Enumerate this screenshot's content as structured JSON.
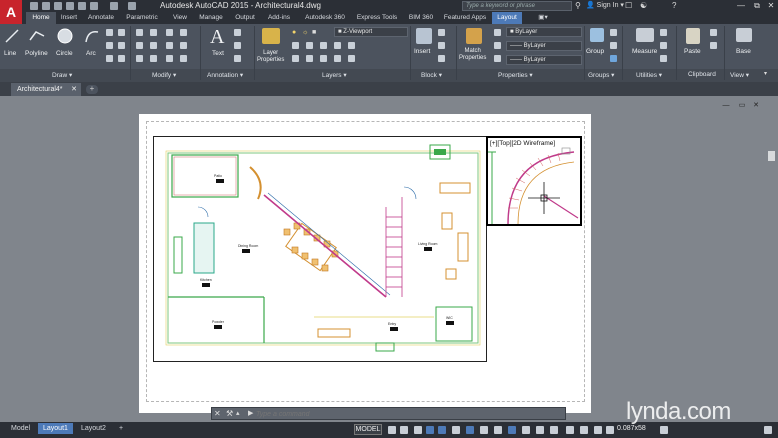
{
  "titlebar": {
    "title": "Autodesk AutoCAD 2015 - Architectural4.dwg",
    "search_placeholder": "Type a keyword or phrase",
    "signin": "Sign In",
    "app_letter": "A"
  },
  "ribbon_tabs": [
    "Home",
    "Insert",
    "Annotate",
    "Parametric",
    "View",
    "Manage",
    "Output",
    "Add-ins",
    "Autodesk 360",
    "Express Tools",
    "BIM 360",
    "Featured Apps",
    "Layout"
  ],
  "ribbon": {
    "draw_tools": [
      "Line",
      "Polyline",
      "Circle",
      "Arc"
    ],
    "panels": [
      "Draw",
      "Modify",
      "Annotation",
      "Layers",
      "Block",
      "Properties",
      "Groups",
      "Utilities",
      "Clipboard",
      "View"
    ],
    "text_tool": "Text",
    "layer_properties": "Layer\nProperties",
    "layer_combo": "Z-Viewport",
    "insert_tool": "Insert",
    "match_properties": "Match\nProperties",
    "bylayer": [
      "ByLayer",
      "ByLayer",
      "ByLayer"
    ],
    "group_tool": "Group",
    "measure_tool": "Measure",
    "paste_tool": "Paste",
    "base_tool": "Base"
  },
  "doc_tab": "Architectural4*",
  "drawing": {
    "detail_label": "[+][Top][2D Wireframe]",
    "room_labels": [
      "Patio",
      "Dining Room",
      "Living Room",
      "Kitchen",
      "Powder",
      "Entry",
      "WIC"
    ]
  },
  "command": {
    "placeholder": "Type a command"
  },
  "status": {
    "layout_tabs": [
      "Model",
      "Layout1",
      "Layout2"
    ],
    "model_label": "MODEL",
    "scale": "0.087x58"
  },
  "watermark": "lynda.com",
  "colors": {
    "title_bg": "#2b2f36",
    "ribbon_bg": "#4c535e",
    "accent": "#4d7ab8",
    "canvas_bg": "#80858c"
  }
}
